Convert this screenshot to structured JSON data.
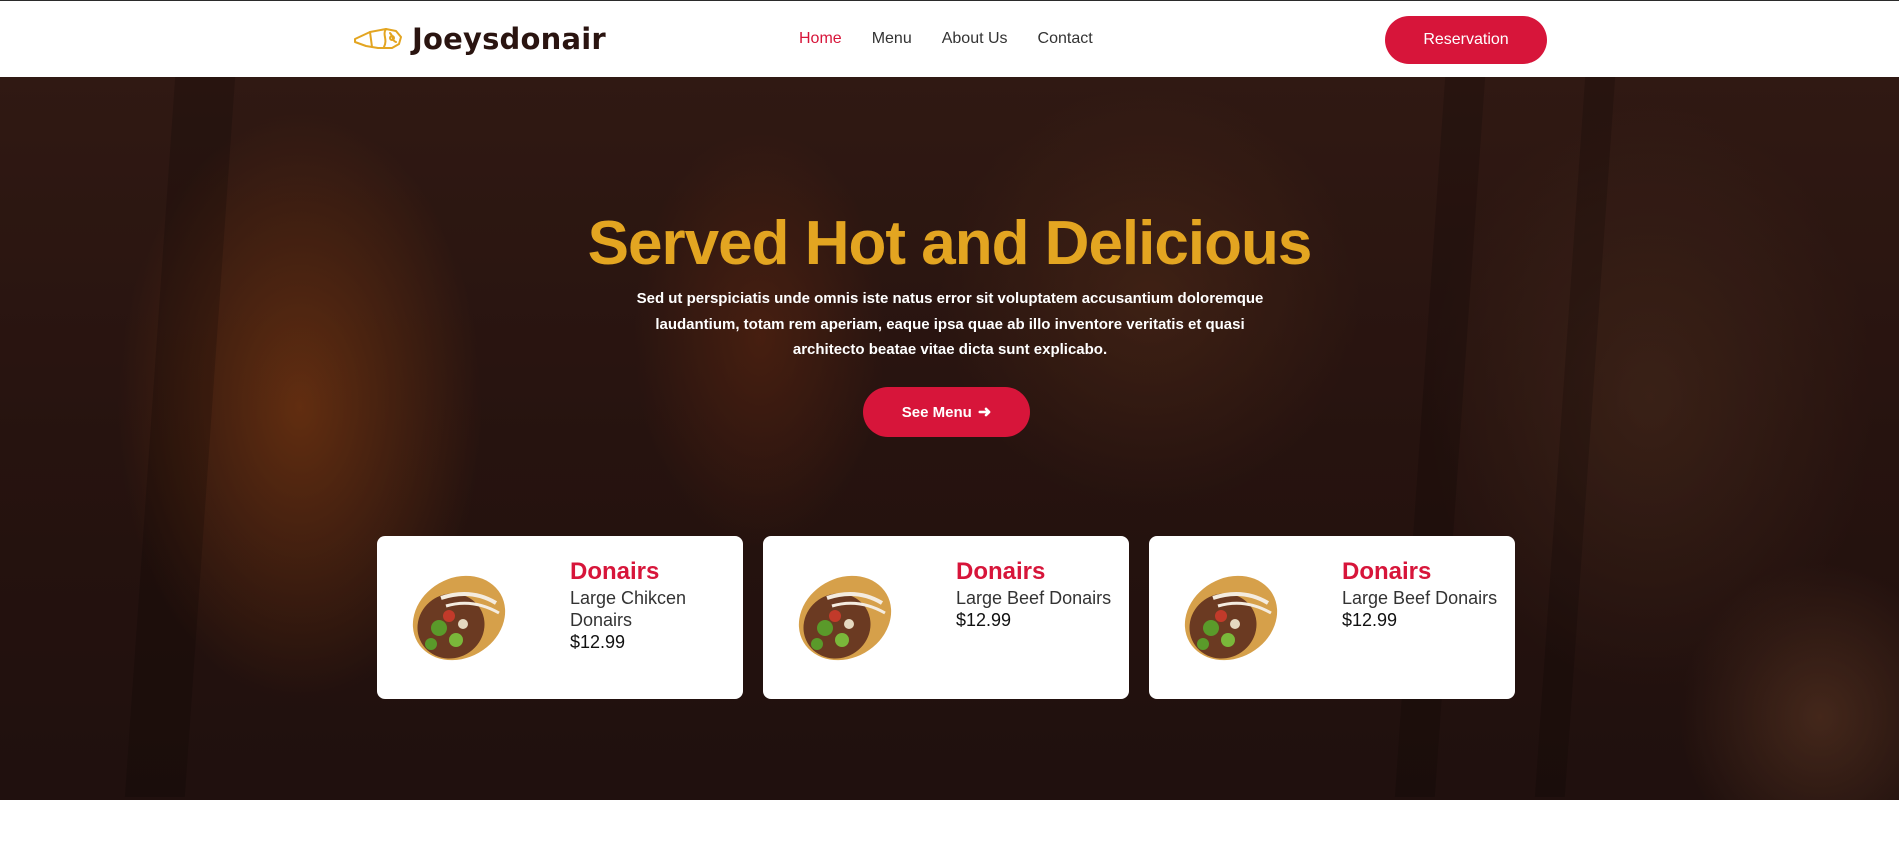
{
  "brand": {
    "name": "Joeysdonair"
  },
  "nav": {
    "items": [
      {
        "label": "Home",
        "active": true
      },
      {
        "label": "Menu",
        "active": false
      },
      {
        "label": "About Us",
        "active": false
      },
      {
        "label": "Contact",
        "active": false
      }
    ],
    "reservation_label": "Reservation"
  },
  "hero": {
    "title": "Served Hot and Delicious",
    "text": "Sed ut perspiciatis unde omnis iste natus error sit voluptatem accusantium doloremque laudantium, totam rem aperiam, eaque ipsa quae ab illo inventore veritatis et quasi architecto beatae vitae dicta sunt explicabo.",
    "button_label": "See Menu",
    "button_icon": "arrow-right-icon"
  },
  "cards": [
    {
      "category": "Donairs",
      "name": "Large Chikcen Donairs",
      "price": "$12.99",
      "icon": "donair-wrap-image"
    },
    {
      "category": "Donairs",
      "name": "Large Beef Donairs",
      "price": "$12.99",
      "icon": "donair-wrap-image"
    },
    {
      "category": "Donairs",
      "name": "Large Beef Donairs",
      "price": "$12.99",
      "icon": "donair-wrap-image"
    }
  ],
  "colors": {
    "accent": "#d7153a",
    "title": "#e3a521",
    "logo_text": "#2a1410",
    "hero_bg": "#2d1712"
  }
}
